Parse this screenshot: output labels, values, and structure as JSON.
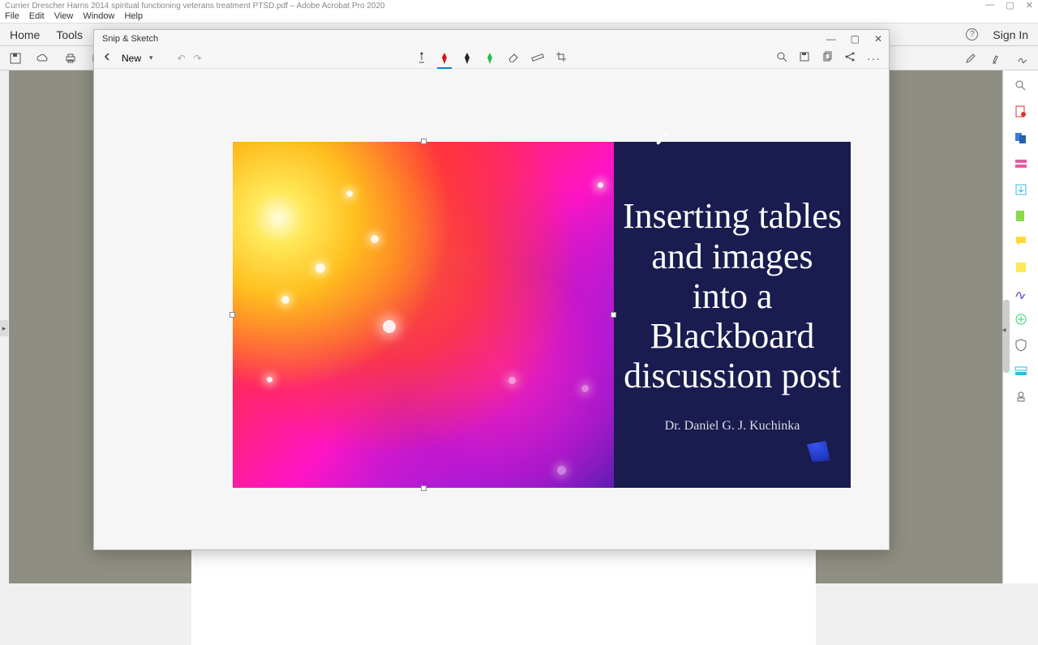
{
  "acrobat": {
    "title_prefix": "Currier Drescher Harris 2014 spiritual functioning veterans treatment PTSD.pdf – Adobe Acrobat Pro 2020",
    "menubar": [
      "File",
      "Edit",
      "View",
      "Window",
      "Help"
    ],
    "tabs": {
      "home": "Home",
      "tools": "Tools",
      "sign_in": "Sign In"
    },
    "right_tools": [
      "search-icon",
      "create-pdf-icon",
      "combine-icon",
      "edit-pdf-icon",
      "export-icon",
      "organize-icon",
      "comment-icon",
      "fill-sign-icon",
      "protect-icon",
      "more-tools-icon",
      "redact-icon",
      "stamp-icon"
    ]
  },
  "snip": {
    "title": "Snip & Sketch",
    "new_label": "New"
  },
  "slide": {
    "heading": "Inserting tables and images into a Blackboard discussion post",
    "author": "Dr. Daniel G. J. Kuchinka"
  }
}
